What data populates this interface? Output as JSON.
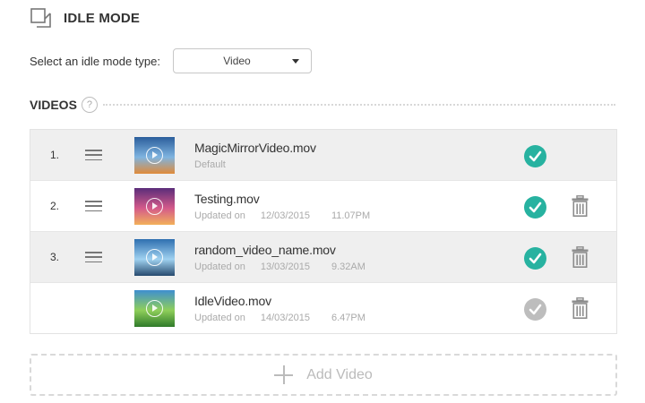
{
  "header": {
    "title": "IDLE MODE",
    "icon": "idle-mode-icon"
  },
  "idle_type": {
    "label": "Select an idle mode type:",
    "selected": "Video"
  },
  "videos": {
    "heading": "VIDEOS",
    "help": "?",
    "items": [
      {
        "index": "1.",
        "name": "MagicMirrorVideo.mov",
        "meta_label": "Default",
        "date": "",
        "time": "",
        "active": true,
        "deletable": false,
        "shaded": true,
        "thumb_colors": [
          "#2b5e9c",
          "#7fb4e0",
          "#e08a3a"
        ]
      },
      {
        "index": "2.",
        "name": "Testing.mov",
        "meta_label": "Updated on",
        "date": "12/03/2015",
        "time": "11.07PM",
        "active": true,
        "deletable": true,
        "shaded": false,
        "thumb_colors": [
          "#5a2d7a",
          "#d45a8a",
          "#f2b05a"
        ]
      },
      {
        "index": "3.",
        "name": "random_video_name.mov",
        "meta_label": "Updated on",
        "date": "13/03/2015",
        "time": "9.32AM",
        "active": true,
        "deletable": true,
        "shaded": true,
        "thumb_colors": [
          "#2e6fb0",
          "#9fd1f0",
          "#274a6e"
        ]
      },
      {
        "index": "",
        "name": "IdleVideo.mov",
        "meta_label": "Updated on",
        "date": "14/03/2015",
        "time": "6.47PM",
        "active": false,
        "deletable": true,
        "shaded": false,
        "thumb_colors": [
          "#3f8fd0",
          "#8fcf5a",
          "#2f7a2a"
        ]
      }
    ]
  },
  "add_video": {
    "label": "Add Video"
  },
  "colors": {
    "accent": "#27b2a0",
    "inactive": "#bdbdbd"
  }
}
